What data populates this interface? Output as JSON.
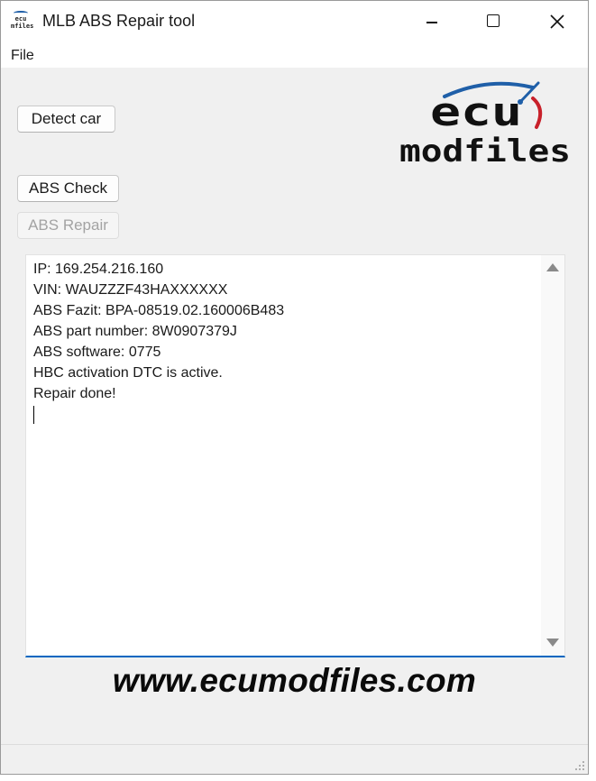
{
  "window": {
    "title": "MLB ABS Repair tool",
    "app_icon_text_top": "ecu",
    "app_icon_text_bottom": "mfiles",
    "controls": [
      "minimize-icon",
      "maximize-icon",
      "close-icon"
    ]
  },
  "menubar": {
    "file_label": "File"
  },
  "buttons": {
    "detect_car": "Detect car",
    "abs_check": "ABS Check",
    "abs_repair": "ABS Repair",
    "abs_repair_enabled": false
  },
  "logo": {
    "top_word": "ecu",
    "bottom_word": "modfiles",
    "arc_color": "#1f5fa8",
    "needle_color": "#c8202a"
  },
  "log": {
    "lines": [
      "IP: 169.254.216.160",
      "VIN: WAUZZZF43HAXXXXXX",
      "ABS Fazit: BPA-08519.02.160006B483",
      "ABS part number: 8W0907379J",
      "ABS software: 0775",
      "HBC activation DTC is active.",
      "Repair done!"
    ]
  },
  "footer": {
    "website": "www.ecumodfiles.com"
  },
  "colors": {
    "accent": "#0067c0",
    "window_bg": "#f0f0f0",
    "disabled_text": "#a3a3a3"
  }
}
